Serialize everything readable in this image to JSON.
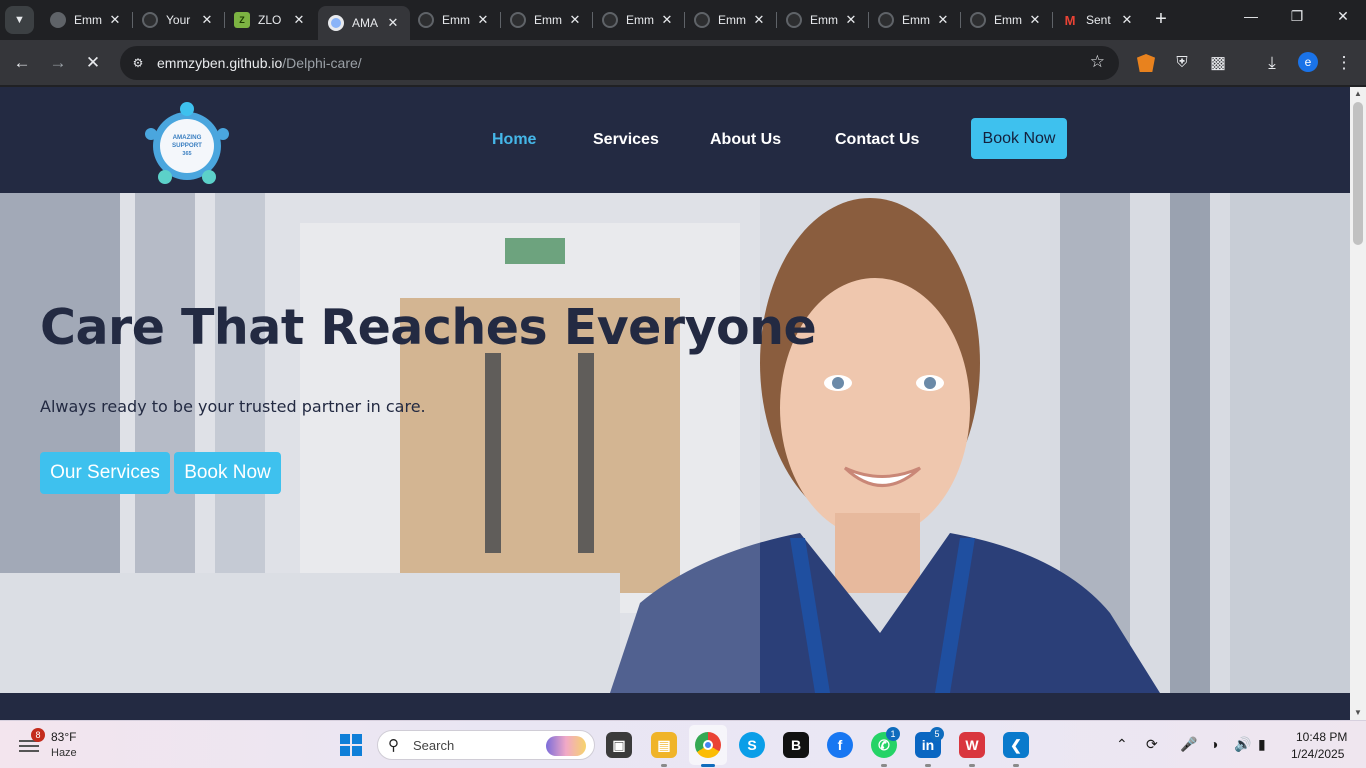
{
  "browser": {
    "tabs": [
      {
        "title": "Emm",
        "favicon": "globe-icon",
        "active": false
      },
      {
        "title": "Your",
        "favicon": "github-icon",
        "active": false
      },
      {
        "title": "ZLO",
        "favicon": "zlo-icon",
        "active": false
      },
      {
        "title": "AMA",
        "favicon": "amazing-support-icon",
        "active": true
      },
      {
        "title": "Emm",
        "favicon": "github-icon",
        "active": false
      },
      {
        "title": "Emm",
        "favicon": "github-icon",
        "active": false
      },
      {
        "title": "Emm",
        "favicon": "github-icon",
        "active": false
      },
      {
        "title": "Emm",
        "favicon": "github-icon",
        "active": false
      },
      {
        "title": "Emm",
        "favicon": "github-icon",
        "active": false
      },
      {
        "title": "Emm",
        "favicon": "github-icon",
        "active": false
      },
      {
        "title": "Emm",
        "favicon": "github-icon",
        "active": false
      },
      {
        "title": "Sent",
        "favicon": "gmail-icon",
        "active": false
      }
    ],
    "url_host": "emmzyben.github.io",
    "url_path": "/Delphi-care/",
    "profile_initial": "e",
    "loading": true
  },
  "site": {
    "logo_text": [
      "AMAZING",
      "SUPPORT",
      "365"
    ],
    "nav": {
      "home": "Home",
      "services": "Services",
      "about": "About Us",
      "contact": "Contact Us",
      "book": "Book Now"
    },
    "hero": {
      "title": "Care That Reaches Everyone",
      "subtitle": "Always ready to be your trusted partner in care.",
      "btn_services": "Our Services",
      "btn_book": "Book Now"
    },
    "colors": {
      "navy": "#232a42",
      "accent": "#3ec1ee",
      "active_link": "#45b7e8"
    }
  },
  "taskbar": {
    "weather_alerts": "8",
    "temperature": "83°F",
    "condition": "Haze",
    "search_placeholder": "Search",
    "whatsapp_badge": "1",
    "linkedin_badge": "5",
    "time": "10:48 PM",
    "date": "1/24/2025"
  }
}
